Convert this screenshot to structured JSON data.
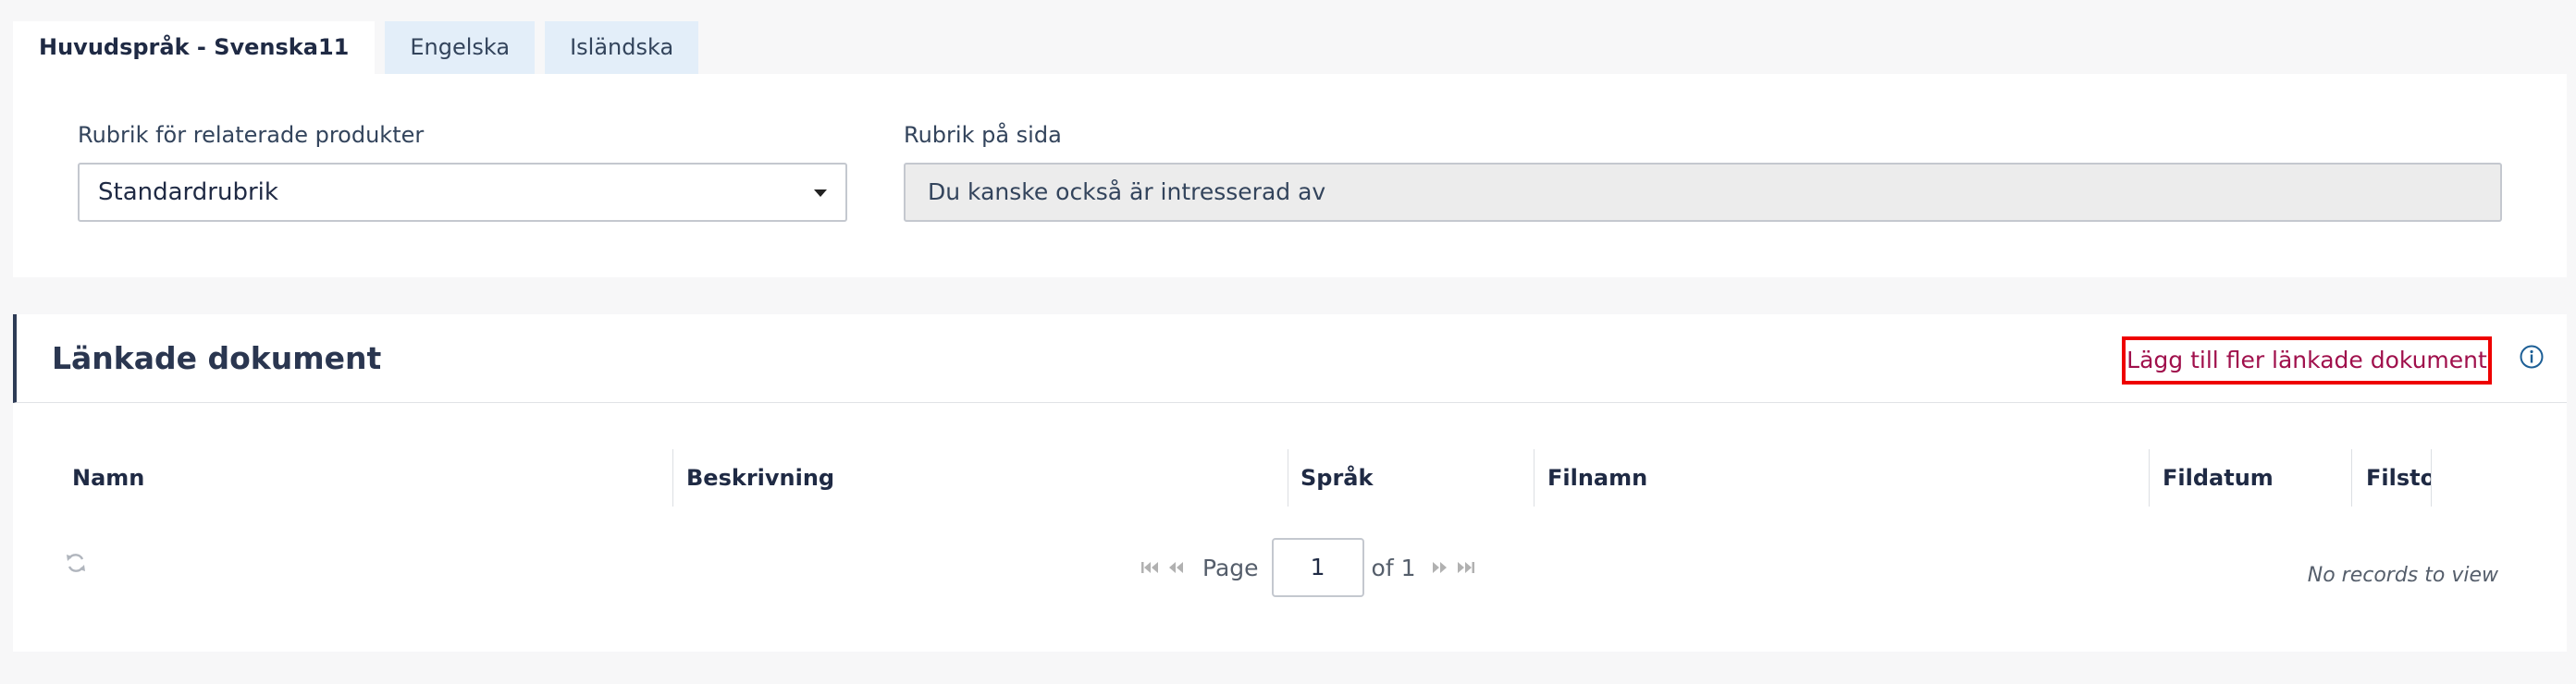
{
  "tabs": [
    {
      "label": "Huvudspråk - Svenska11",
      "active": true
    },
    {
      "label": "Engelska",
      "active": false
    },
    {
      "label": "Isländska",
      "active": false
    }
  ],
  "form": {
    "related_label": "Rubrik för relaterade produkter",
    "related_value": "Standardrubrik",
    "page_label": "Rubrik på sida",
    "page_value": "Du kanske också är intresserad av"
  },
  "linked_docs": {
    "title": "Länkade dokument",
    "add_label": "Lägg till fler länkade dokument",
    "columns": [
      "Namn",
      "Beskrivning",
      "Språk",
      "Filnamn",
      "Fildatum",
      "Filstorlek"
    ],
    "pager": {
      "page_label": "Page",
      "page_value": "1",
      "of_label": "of 1"
    },
    "empty_text": "No records to view"
  },
  "icons": {
    "dropdown": "caret-down-icon",
    "info": "info-icon",
    "refresh": "refresh-icon"
  },
  "colors": {
    "accent": "#a0104c",
    "highlight": "#ee0000",
    "tab_bg": "#e3eef9",
    "header_bar": "#2d3b55"
  }
}
